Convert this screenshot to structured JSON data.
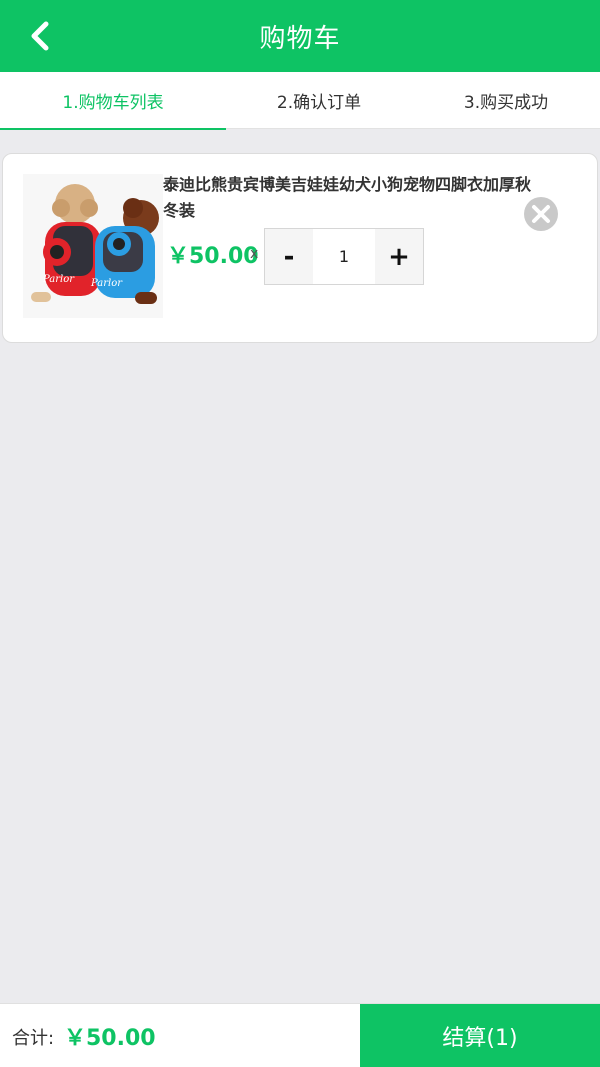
{
  "header": {
    "title": "购物车",
    "back_icon": "chevron-left-icon"
  },
  "steps": [
    {
      "label": "1.购物车列表",
      "active": true
    },
    {
      "label": "2.确认订单",
      "active": false
    },
    {
      "label": "3.购买成功",
      "active": false
    }
  ],
  "cart": {
    "items": [
      {
        "title": "泰迪比熊贵宾博美吉娃娃幼犬小狗宠物四脚衣加厚秋冬装",
        "price": "￥50.00",
        "times": "x",
        "quantity": "1",
        "decrement": "-",
        "increment": "+",
        "remove_icon": "close-circle-icon",
        "image_text": "Parlor"
      }
    ]
  },
  "footer": {
    "total_label": "合计:",
    "total_value": "￥50.00",
    "checkout_label": "结算(1)"
  },
  "colors": {
    "accent": "#0ec364",
    "background": "#ebebee"
  }
}
